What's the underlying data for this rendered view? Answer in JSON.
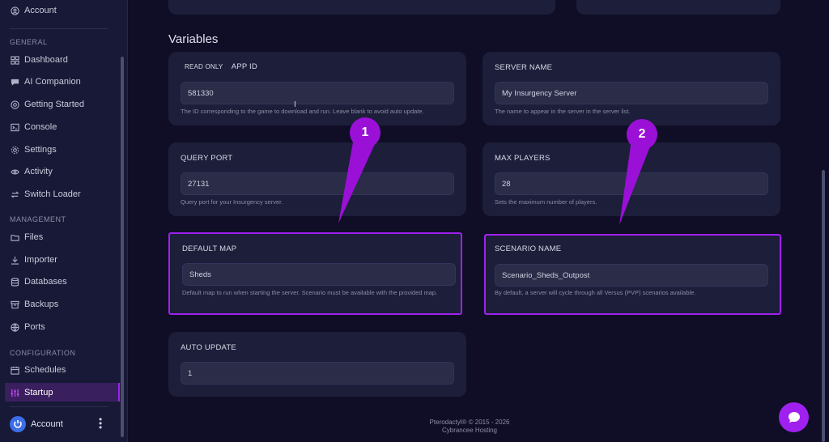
{
  "sidebar": {
    "top_account": "Account",
    "sections": {
      "general": "GENERAL",
      "management": "MANAGEMENT",
      "configuration": "CONFIGURATION"
    },
    "items": [
      {
        "label": "Dashboard",
        "icon": "grid-icon"
      },
      {
        "label": "AI Companion",
        "icon": "chat-icon"
      },
      {
        "label": "Getting Started",
        "icon": "lifebuoy-icon"
      },
      {
        "label": "Console",
        "icon": "terminal-icon"
      },
      {
        "label": "Settings",
        "icon": "gear-icon"
      },
      {
        "label": "Activity",
        "icon": "eye-icon"
      },
      {
        "label": "Switch Loader",
        "icon": "swap-icon"
      },
      {
        "label": "Files",
        "icon": "folder-icon"
      },
      {
        "label": "Importer",
        "icon": "download-icon"
      },
      {
        "label": "Databases",
        "icon": "database-icon"
      },
      {
        "label": "Backups",
        "icon": "archive-icon"
      },
      {
        "label": "Ports",
        "icon": "globe-icon"
      },
      {
        "label": "Schedules",
        "icon": "calendar-icon"
      },
      {
        "label": "Startup",
        "icon": "sliders-icon",
        "active": true
      }
    ],
    "bottom_account": "Account"
  },
  "main": {
    "title": "Variables",
    "variables": [
      {
        "readonly_label": "READ ONLY",
        "label": "APP ID",
        "value": "581330",
        "help": "The ID corresponding to the game to download and run. Leave blank to avoid auto update."
      },
      {
        "label": "SERVER NAME",
        "value": "My Insurgency Server",
        "help": "The name to appear in the server in the server list."
      },
      {
        "label": "QUERY PORT",
        "value": "27131",
        "help": "Query port for your Insurgency server."
      },
      {
        "label": "MAX PLAYERS",
        "value": "28",
        "help": "Sets the maximum number of players."
      },
      {
        "label": "DEFAULT MAP",
        "value": "Sheds",
        "help": "Default map to run when starting the server. Scenario must be available with the provided map."
      },
      {
        "label": "SCENARIO NAME",
        "value": "Scenario_Sheds_Outpost",
        "help": "By default, a server will cycle through all Versus (PVP) scenarios available."
      },
      {
        "label": "AUTO UPDATE",
        "value": "1",
        "help": ""
      }
    ]
  },
  "footer": {
    "line1": "Pterodactyl® © 2015 - 2026",
    "line2": "Cybrancee Hosting"
  },
  "callouts": [
    "1",
    "2"
  ],
  "colors": {
    "accent": "#a020f0",
    "background": "#0f0e26",
    "card": "#1c1e3a"
  }
}
